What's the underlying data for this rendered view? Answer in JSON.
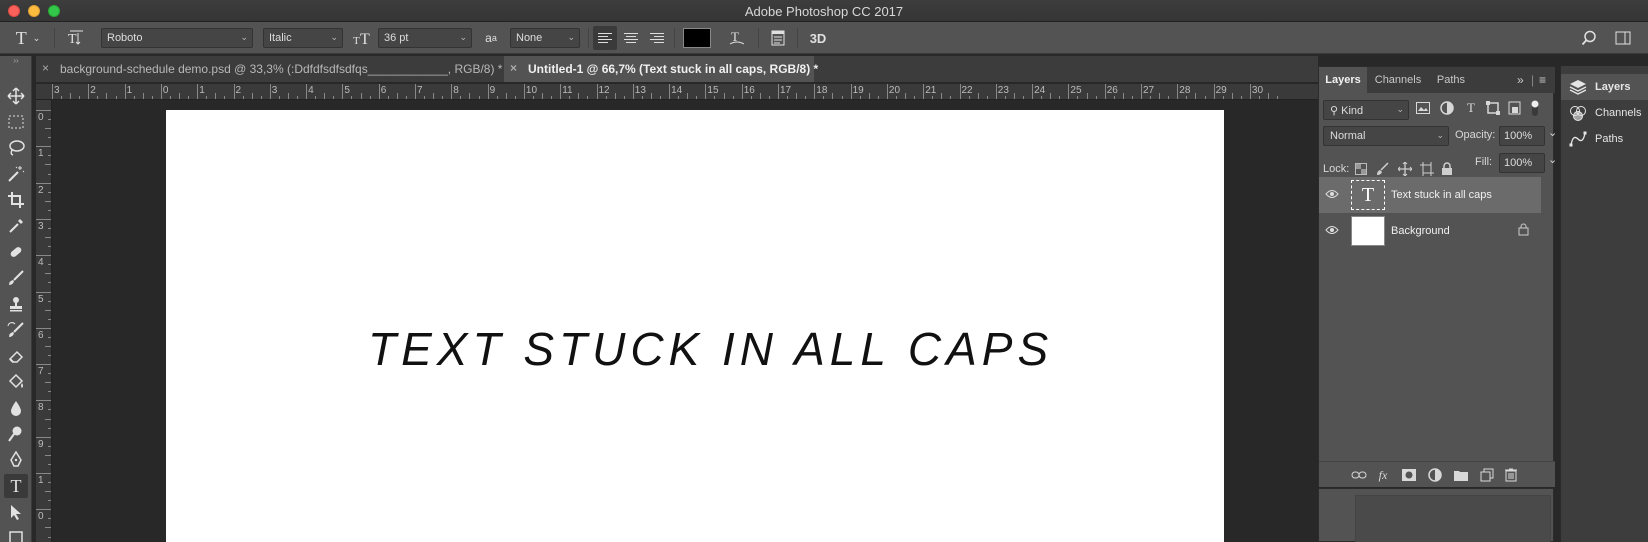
{
  "app": {
    "title": "Adobe Photoshop CC 2017"
  },
  "options_bar": {
    "font_family": "Roboto",
    "font_style": "Italic",
    "font_size": "36 pt",
    "anti_alias": "None",
    "aa_icon_label": "a",
    "three_d_label": "3D",
    "text_color": "#000000"
  },
  "tabs": [
    {
      "label": "background-schedule demo.psd @ 33,3% (:Ddfdfsdfsdfqs____________, RGB/8) *",
      "active": false
    },
    {
      "label": "Untitled-1 @ 66,7% (Text stuck in all caps, RGB/8) *",
      "active": true
    }
  ],
  "rulers": {
    "horizontal_labels": [
      "3",
      "2",
      "1",
      "0",
      "1",
      "2",
      "3",
      "4",
      "5",
      "6",
      "7",
      "8",
      "9",
      "10",
      "11",
      "12",
      "13",
      "14",
      "15",
      "16",
      "17",
      "18",
      "19",
      "20",
      "21",
      "22",
      "23",
      "24",
      "25",
      "26",
      "27",
      "28",
      "29",
      "30"
    ],
    "vertical_labels": [
      "0",
      "1",
      "2",
      "3",
      "4",
      "5",
      "6",
      "7",
      "8",
      "9",
      "1",
      "0"
    ]
  },
  "canvas": {
    "text": "TEXT STUCK IN ALL CAPS"
  },
  "layers_panel": {
    "tabs": [
      "Layers",
      "Channels",
      "Paths"
    ],
    "kind_label": "Kind",
    "blend_mode": "Normal",
    "opacity_label": "Opacity:",
    "opacity_value": "100%",
    "lock_label": "Lock:",
    "fill_label": "Fill:",
    "fill_value": "100%",
    "layers": [
      {
        "name": "Text stuck in all caps",
        "type": "text",
        "selected": true
      },
      {
        "name": "Background",
        "type": "background",
        "selected": false
      }
    ],
    "fx_label": "fx"
  },
  "dock": {
    "items": [
      "Layers",
      "Channels",
      "Paths"
    ]
  }
}
